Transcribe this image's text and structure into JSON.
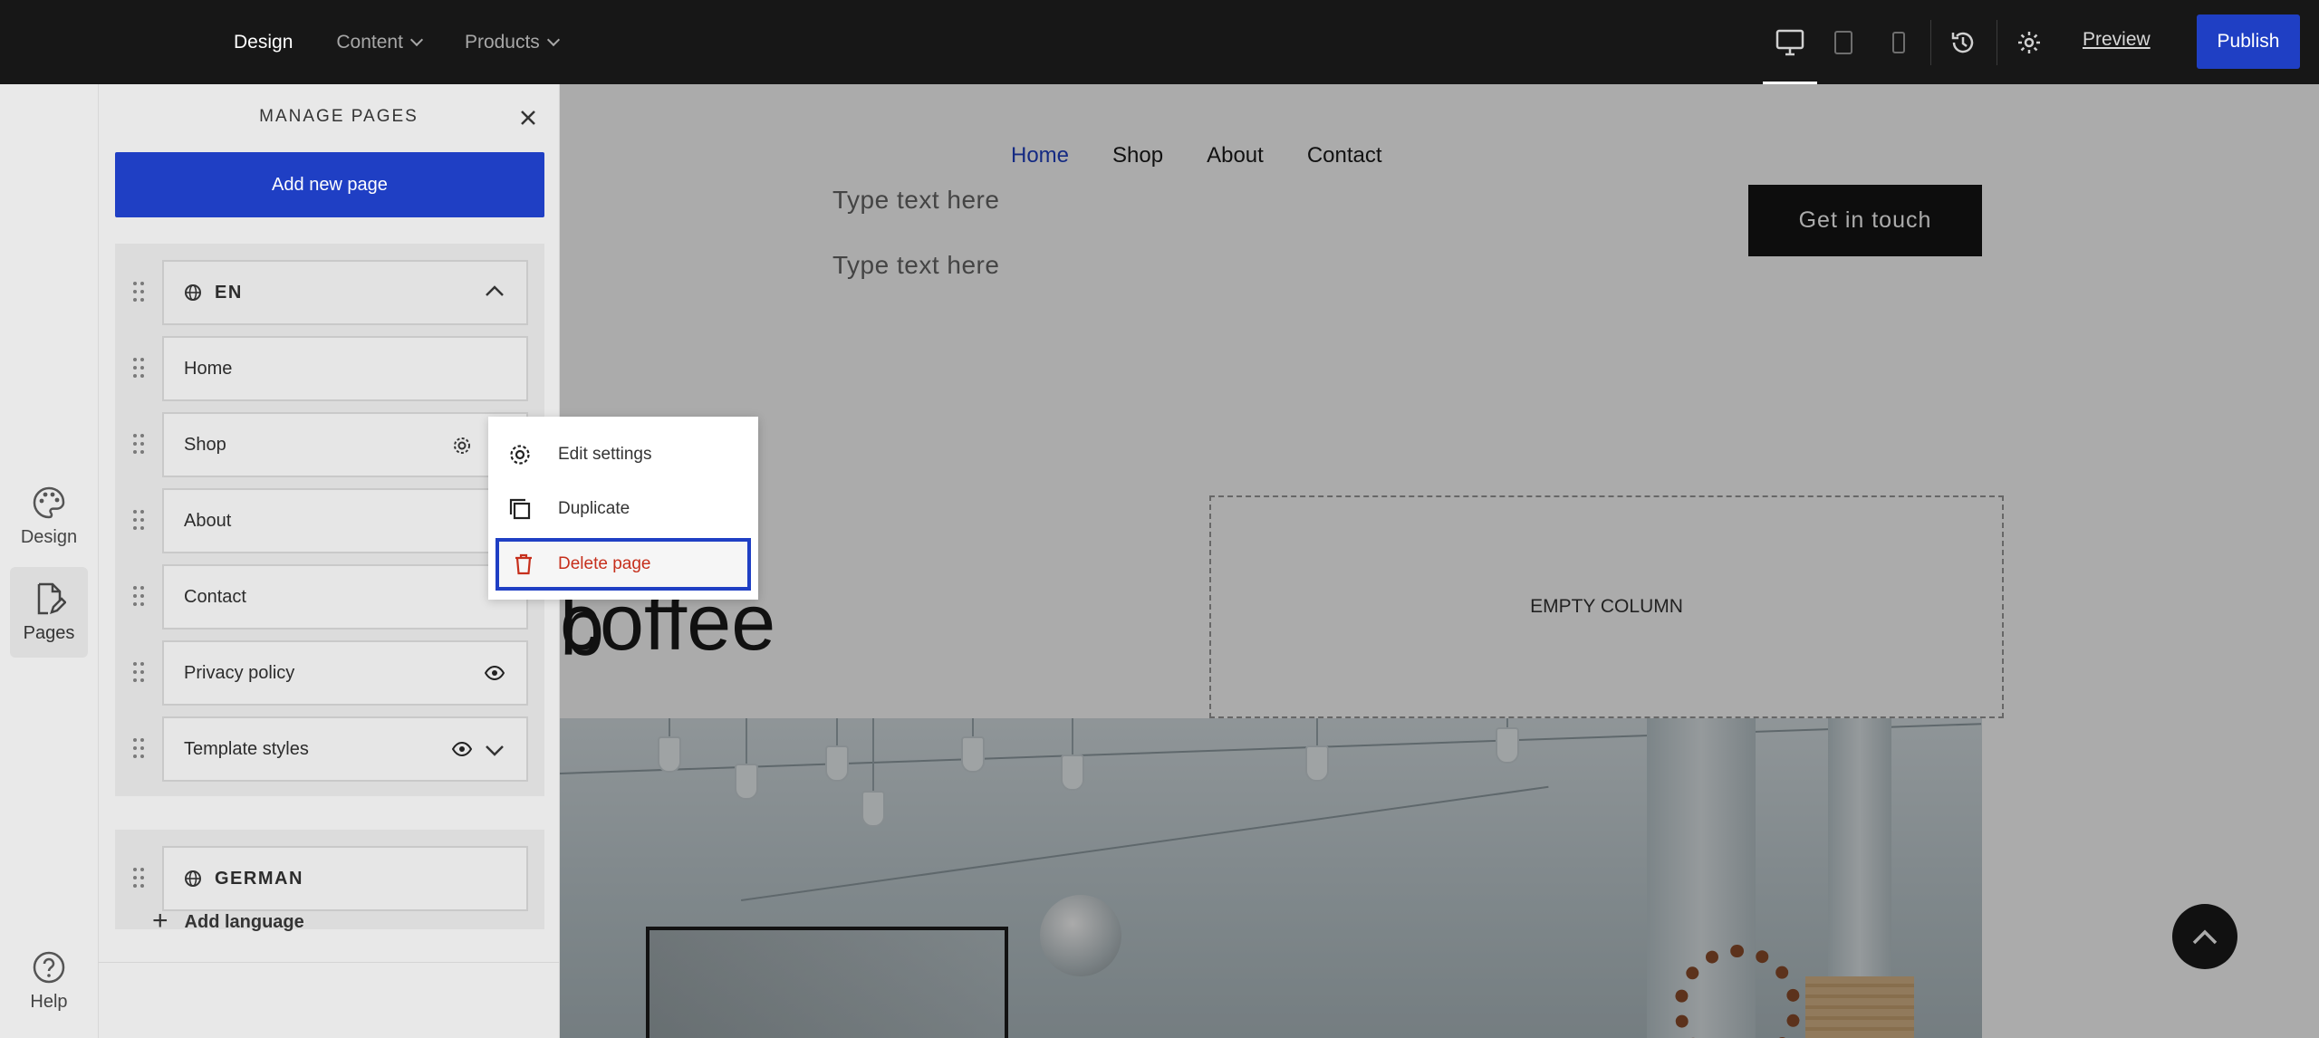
{
  "topbar": {
    "nav": [
      {
        "label": "Design"
      },
      {
        "label": "Content"
      },
      {
        "label": "Products"
      }
    ],
    "preview_label": "Preview",
    "publish_label": "Publish"
  },
  "rail": {
    "design_label": "Design",
    "pages_label": "Pages",
    "help_label": "Help"
  },
  "panel": {
    "title": "MANAGE PAGES",
    "add_page_label": "Add new page",
    "languages": [
      {
        "code": "EN",
        "pages": [
          {
            "label": "Home"
          },
          {
            "label": "Shop"
          },
          {
            "label": "About"
          },
          {
            "label": "Contact"
          },
          {
            "label": "Privacy policy"
          },
          {
            "label": "Template styles"
          }
        ]
      },
      {
        "code": "GERMAN"
      }
    ],
    "add_language_label": "Add language"
  },
  "context_menu": {
    "items": [
      {
        "label": "Edit settings"
      },
      {
        "label": "Duplicate"
      },
      {
        "label": "Delete page"
      }
    ]
  },
  "site": {
    "nav": [
      {
        "label": "Home"
      },
      {
        "label": "Shop"
      },
      {
        "label": "About"
      },
      {
        "label": "Contact"
      }
    ],
    "type_text_1": "Type text here",
    "type_text_2": "Type text here",
    "cta_label": "Get in touch",
    "headline_line1": "r coffee",
    "headline_line2": "b",
    "empty_column_label": "EMPTY COLUMN"
  },
  "colors": {
    "accent": "#1f3fc4",
    "danger": "#c62f1c",
    "topbar_bg": "#171717"
  }
}
